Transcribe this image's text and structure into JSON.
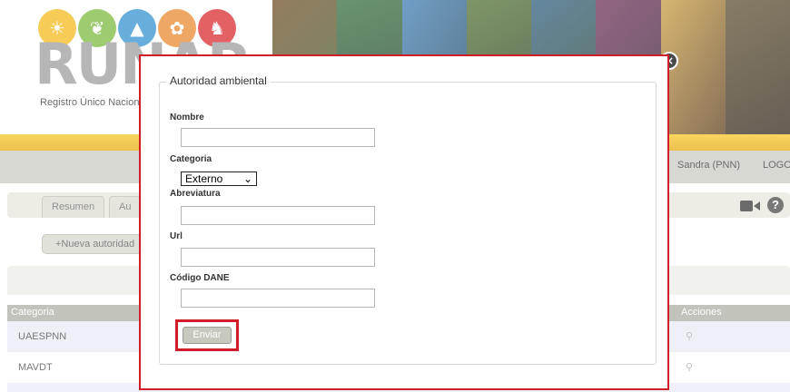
{
  "logo": {
    "word": "RUNAP",
    "subtitle": "Registro Único Nacional de Áreas Protegidas",
    "circles": [
      {
        "icon": "sun-icon",
        "color": "#f3b715",
        "glyph": "☀"
      },
      {
        "icon": "leaf-icon",
        "color": "#7ab83a",
        "glyph": "❦"
      },
      {
        "icon": "mountain-icon",
        "color": "#2e8fcf",
        "glyph": "▲"
      },
      {
        "icon": "plant-icon",
        "color": "#e9862a",
        "glyph": "✿"
      },
      {
        "icon": "animal-icon",
        "color": "#d8232a",
        "glyph": "♞"
      }
    ]
  },
  "header": {
    "user": "Sandra (PNN)",
    "logout": "LOGOUT"
  },
  "tabs": [
    {
      "label": "Resumen"
    },
    {
      "label": "Au"
    }
  ],
  "toolbar": {
    "video_icon": "video-camera-icon",
    "help_icon": "help-icon",
    "help_glyph": "?"
  },
  "new_button": "+Nueva autoridad",
  "table": {
    "headers": {
      "categoria": "Categoria",
      "acciones": "Acciones"
    },
    "rows": [
      {
        "categoria": "UAESPNN",
        "accion": "⚲"
      },
      {
        "categoria": "MAVDT",
        "accion": "⚲"
      }
    ]
  },
  "modal": {
    "legend": "Autoridad ambiental",
    "close_glyph": "×",
    "fields": {
      "nombre": {
        "label": "Nombre",
        "value": ""
      },
      "categoria": {
        "label": "Categoria",
        "selected": "Externo",
        "arrow": "⌄"
      },
      "abreviatura": {
        "label": "Abreviatura",
        "value": ""
      },
      "url": {
        "label": "Url",
        "value": ""
      },
      "codigo_dane": {
        "label": "Código DANE",
        "value": ""
      }
    },
    "submit": "Enviar"
  },
  "colors": {
    "highlight": "#cf1e28",
    "yellow_bar": "#f6c622",
    "nav_gray": "#c8c9c0"
  }
}
